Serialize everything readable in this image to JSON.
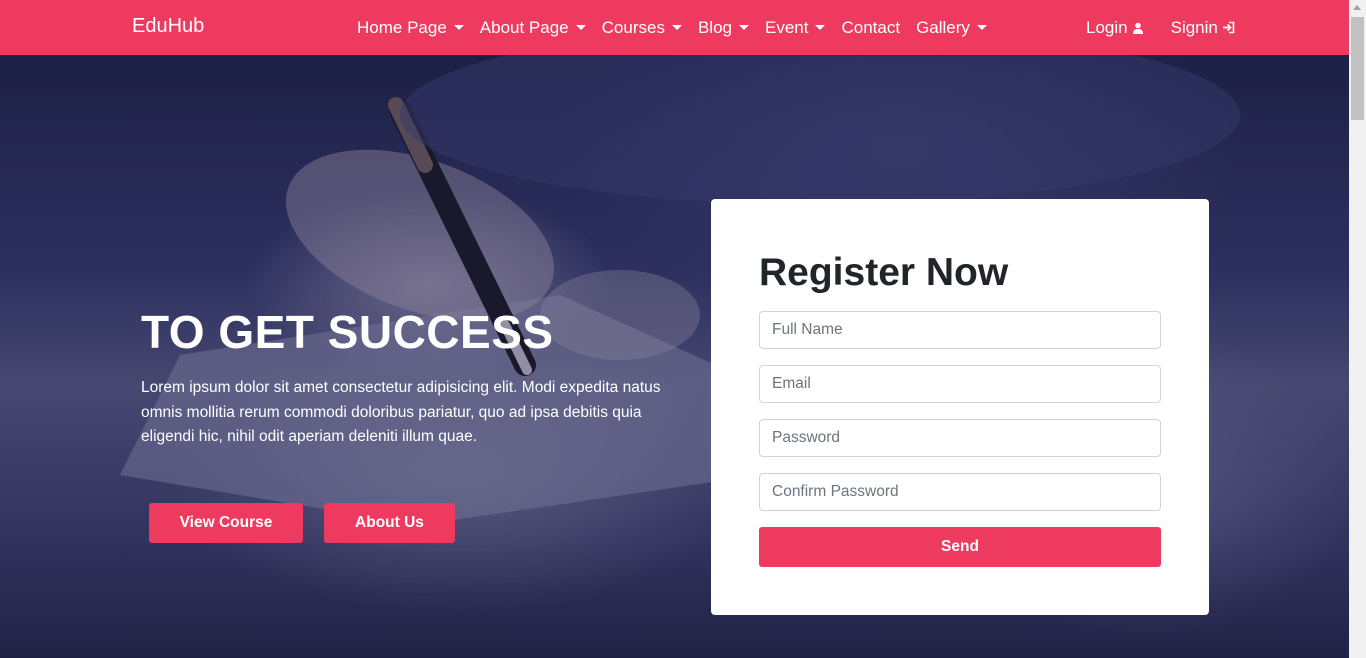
{
  "nav": {
    "brand": "EduHub",
    "items": [
      {
        "label": "Home Page",
        "dropdown": true
      },
      {
        "label": "About Page",
        "dropdown": true
      },
      {
        "label": "Courses",
        "dropdown": true
      },
      {
        "label": "Blog",
        "dropdown": true
      },
      {
        "label": "Event",
        "dropdown": true
      },
      {
        "label": "Contact",
        "dropdown": false
      },
      {
        "label": "Gallery",
        "dropdown": true
      }
    ],
    "login": {
      "label": "Login",
      "icon": "user-icon"
    },
    "signin": {
      "label": "Signin",
      "icon": "sign-in-icon"
    }
  },
  "hero": {
    "title": "TO GET SUCCESS",
    "text": "Lorem ipsum dolor sit amet consectetur adipisicing elit. Modi expedita natus omnis mollitia rerum commodi doloribus pariatur, quo ad ipsa debitis quia eligendi hic, nihil odit aperiam deleniti illum quae.",
    "view_course": "View Course",
    "about_us": "About Us"
  },
  "register": {
    "title": "Register Now",
    "full_name_placeholder": "Full Name",
    "email_placeholder": "Email",
    "password_placeholder": "Password",
    "confirm_password_placeholder": "Confirm Password",
    "send": "Send"
  },
  "colors": {
    "accent": "#ee3a5e",
    "card_bg": "#ffffff",
    "text_dark": "#212529"
  }
}
